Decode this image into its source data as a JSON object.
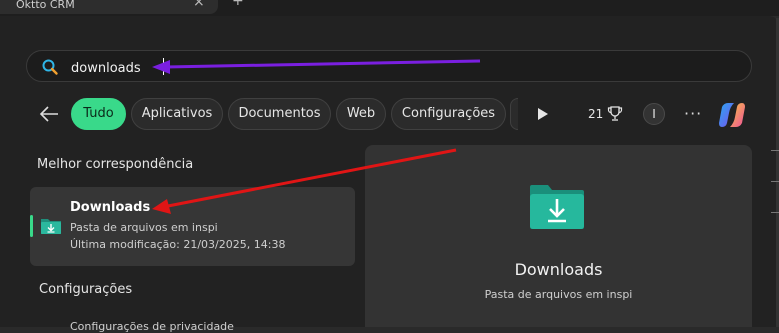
{
  "browser": {
    "tab_title": "Oktto CRM",
    "close_glyph": "×",
    "new_tab_glyph": "+"
  },
  "search": {
    "value": "downloads",
    "icon": "search-icon"
  },
  "filters": {
    "back_icon": "back-arrow-icon",
    "chips": [
      {
        "label": "Tudo",
        "active": true
      },
      {
        "label": "Aplicativos",
        "active": false
      },
      {
        "label": "Documentos",
        "active": false
      },
      {
        "label": "Web",
        "active": false
      },
      {
        "label": "Configurações",
        "active": false
      }
    ],
    "points_count": "21",
    "avatar_initial": "I",
    "more_label": "···"
  },
  "best_match": {
    "heading": "Melhor correspondência",
    "title": "Downloads",
    "subtitle": "Pasta de arquivos em inspi",
    "modified": "Última modificação: 21/03/2025, 14:38"
  },
  "settings": {
    "heading": "Configurações",
    "partial_item": "Configurações de privacidade"
  },
  "detail": {
    "title": "Downloads",
    "subtitle": "Pasta de arquivos em inspi"
  },
  "colors": {
    "accent": "#39d98a",
    "annotation_purple": "#7a1fe0",
    "annotation_red": "#e01515",
    "folder_teal": "#1bb39a"
  }
}
